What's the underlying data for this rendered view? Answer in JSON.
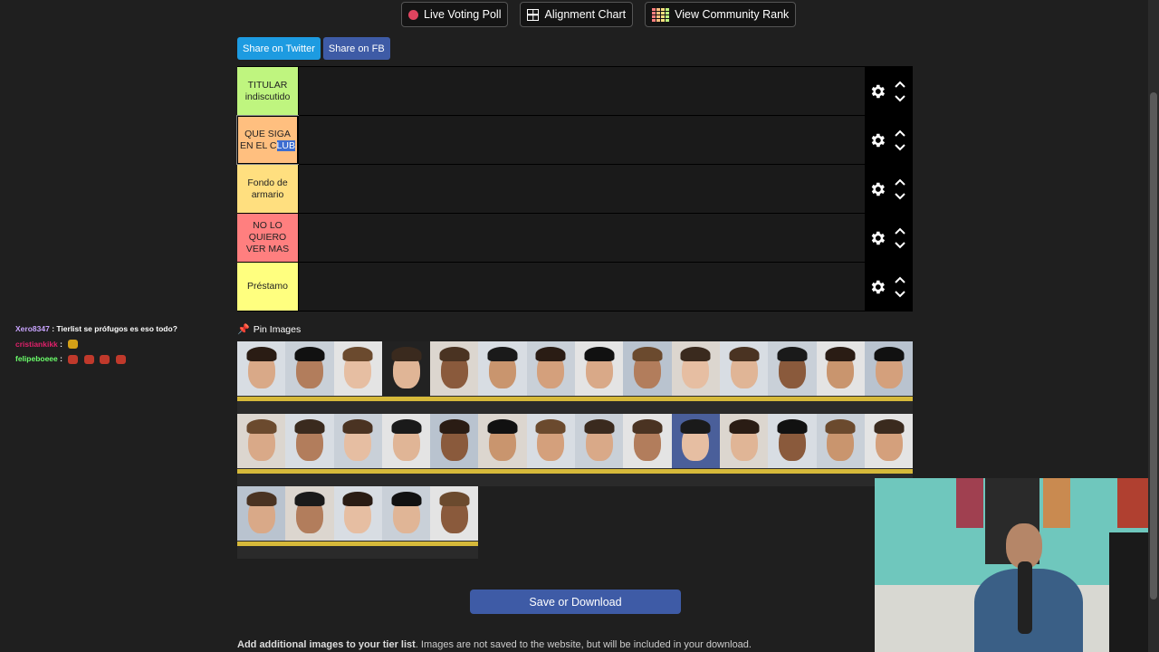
{
  "nav": {
    "live_voting_poll": "Live Voting Poll",
    "alignment_chart": "Alignment Chart",
    "view_community_rank": "View Community Rank"
  },
  "share": {
    "twitter": "Share on Twitter",
    "fb": "Share on FB"
  },
  "tiers": [
    {
      "label": "TITULAR indiscutido",
      "color": "#bff57f"
    },
    {
      "label_pre": "QUE SIGA EN EL C",
      "label_hl": "LUB",
      "color": "#ffbf7f"
    },
    {
      "label": "Fondo de armario",
      "color": "#ffdf7f"
    },
    {
      "label": "NO LO QUIERO VER MAS",
      "color": "#ff7f7f"
    },
    {
      "label": "Préstamo",
      "color": "#ffff7f"
    }
  ],
  "pin_images": "Pin Images",
  "save_button": "Save or Download",
  "add_images_bold": "Add additional images to your tier list",
  "add_images_rest": ". Images are not saved to the website, but will be included in your download.",
  "chat": [
    {
      "user": "Xero8347",
      "message": ": Tierlist se prófugos es eso todo?"
    },
    {
      "user": "cristiankikk",
      "message": ":"
    },
    {
      "user": "felipeboeee",
      "message": ":"
    }
  ],
  "pool_count": 33
}
